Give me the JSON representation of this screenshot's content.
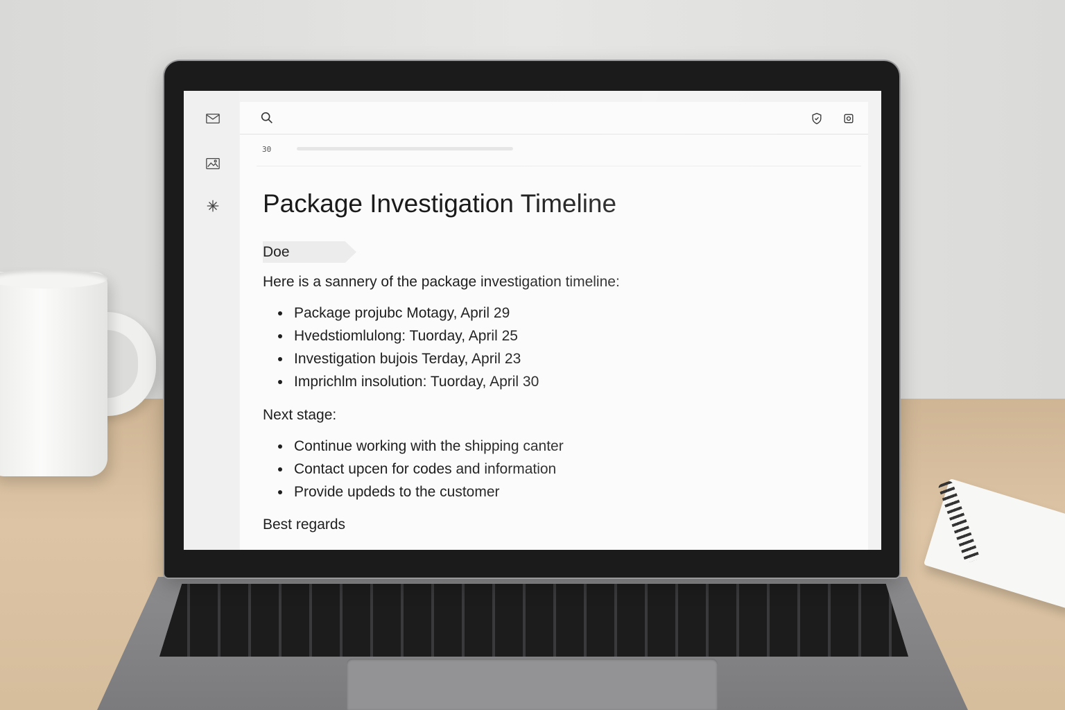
{
  "app": {
    "search_icon": "search-icon",
    "top_icons": [
      "shield-check-icon",
      "record-icon"
    ],
    "sidebar_icons": [
      "mail-icon",
      "image-icon",
      "sparkle-icon"
    ]
  },
  "subbar": {
    "count": "30"
  },
  "document": {
    "title": "Package Investigation Timeline",
    "status_tag": "Doe",
    "intro": "Here is a sannery of the package investigation timeline:",
    "timeline": [
      "Package projubc Motagy, April 29",
      "Hvedstiomlulong: Tuorday, April 25",
      "Investigation bujois Terday, April 23",
      "Imprichlm insolution: Tuorday, April 30"
    ],
    "next_heading": "Next stage:",
    "next_steps": [
      "Continue working with the shipping canter",
      "Contact upcen for codes and information",
      "Provide updeds to the customer"
    ],
    "closing": "Best regards"
  }
}
